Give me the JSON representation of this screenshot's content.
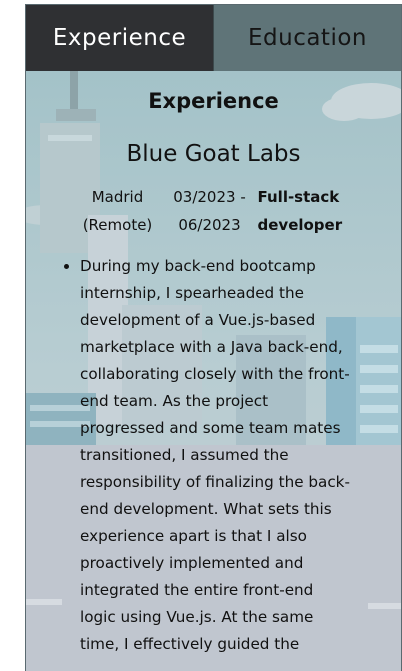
{
  "tabs": [
    {
      "label": "Experience",
      "active": true
    },
    {
      "label": "Education",
      "active": false
    }
  ],
  "section_title": "Experience",
  "job": {
    "company": "Blue Goat Labs",
    "location_line1": "Madrid",
    "location_line2": "(Remote)",
    "date_start": "03/2023 -",
    "date_end": "06/2023",
    "role_line1": "Full-stack",
    "role_line2": "developer",
    "description": "During my back-end bootcamp internship, I spearheaded the development of a Vue.js-based marketplace with a Java back-end, collaborating closely with the front-end team. As the project progressed and some team mates transitioned, I assumed the responsibility of finalizing the back-end development. What sets this experience apart is that I also proactively implemented and integrated the entire front-end logic using Vue.js. At the same time, I effectively guided the"
  },
  "colors": {
    "active_tab": "#2f3033",
    "inactive_tab": "#5f7478",
    "background": "#a9c3c9"
  }
}
